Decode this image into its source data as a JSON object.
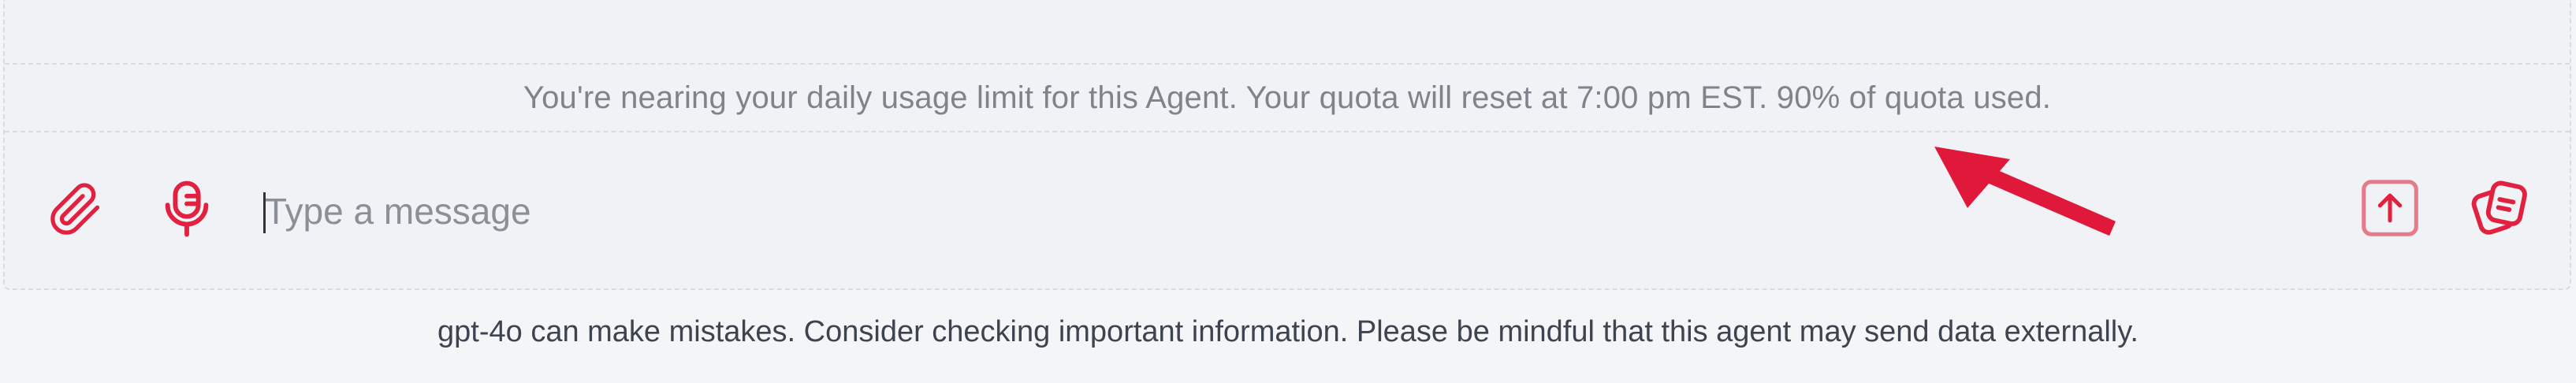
{
  "composer": {
    "quota_notice": "You're nearing your daily usage limit for this Agent. Your quota will reset at 7:00 pm EST. 90% of quota used.",
    "input": {
      "placeholder": "Type a message",
      "value": ""
    },
    "icons": {
      "attach": "paperclip-icon",
      "microphone": "microphone-icon",
      "send": "arrow-up-icon",
      "copy": "copy-icon"
    },
    "accent_color": "#e0213f"
  },
  "footer": {
    "disclaimer": "gpt-4o can make mistakes. Consider checking important information. Please be mindful that this agent may send data externally."
  }
}
